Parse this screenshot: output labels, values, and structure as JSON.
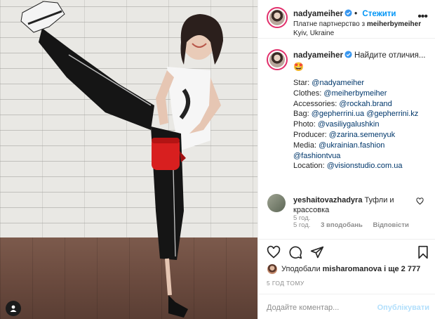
{
  "header": {
    "username": "nadyameiher",
    "follow_label": "Стежити",
    "partnership_prefix": "Платне партнерство з",
    "partner": "meiherbymeiher",
    "location": "Kyiv, Ukraine",
    "more_label": "•••"
  },
  "caption": {
    "username": "nadyameiher",
    "text": "Найдите отличия...",
    "emoji": "🤩",
    "credits": [
      {
        "label": "Star:",
        "links": [
          "@nadyameiher"
        ]
      },
      {
        "label": "Clothes:",
        "links": [
          "@meiherbymeiher"
        ]
      },
      {
        "label": "Accessories:",
        "links": [
          "@rockah.brand"
        ]
      },
      {
        "label": "Bag:",
        "links": [
          "@gepherrini.ua",
          "@gepherrini.kz"
        ]
      },
      {
        "label": "Photo:",
        "links": [
          "@vasiliygalushkin"
        ]
      },
      {
        "label": "Producer:",
        "links": [
          "@zarina.semenyuk"
        ]
      },
      {
        "label": "Media:",
        "links": [
          "@ukrainian.fashion"
        ]
      },
      {
        "label": "",
        "links": [
          "@fashiontvua"
        ]
      },
      {
        "label": "Location:",
        "links": [
          "@visionstudio.com.ua"
        ]
      }
    ],
    "time": "5 год."
  },
  "comment": {
    "username": "yeshaitovazhadyra",
    "text": "Туфли и крассовка",
    "time": "5 год.",
    "likes": "3 вподобань",
    "reply": "Відповісти"
  },
  "likes": {
    "prefix": "Уподобали",
    "user": "misharomanova",
    "suffix": "і ще 2 777"
  },
  "posted_ago": "5 ГОД ТОМУ",
  "add_comment": {
    "placeholder": "Додайте коментар...",
    "post_label": "Опублікувати"
  },
  "icons": {
    "verified": "verified-badge-icon",
    "heart": "heart-icon",
    "comment": "comment-icon",
    "share": "share-icon",
    "save": "bookmark-icon",
    "tag": "user-tag-icon"
  },
  "colors": {
    "accent": "#0095f6",
    "link": "#00376b",
    "muted": "#8e8e8e",
    "post_disabled": "#b2dffc"
  }
}
